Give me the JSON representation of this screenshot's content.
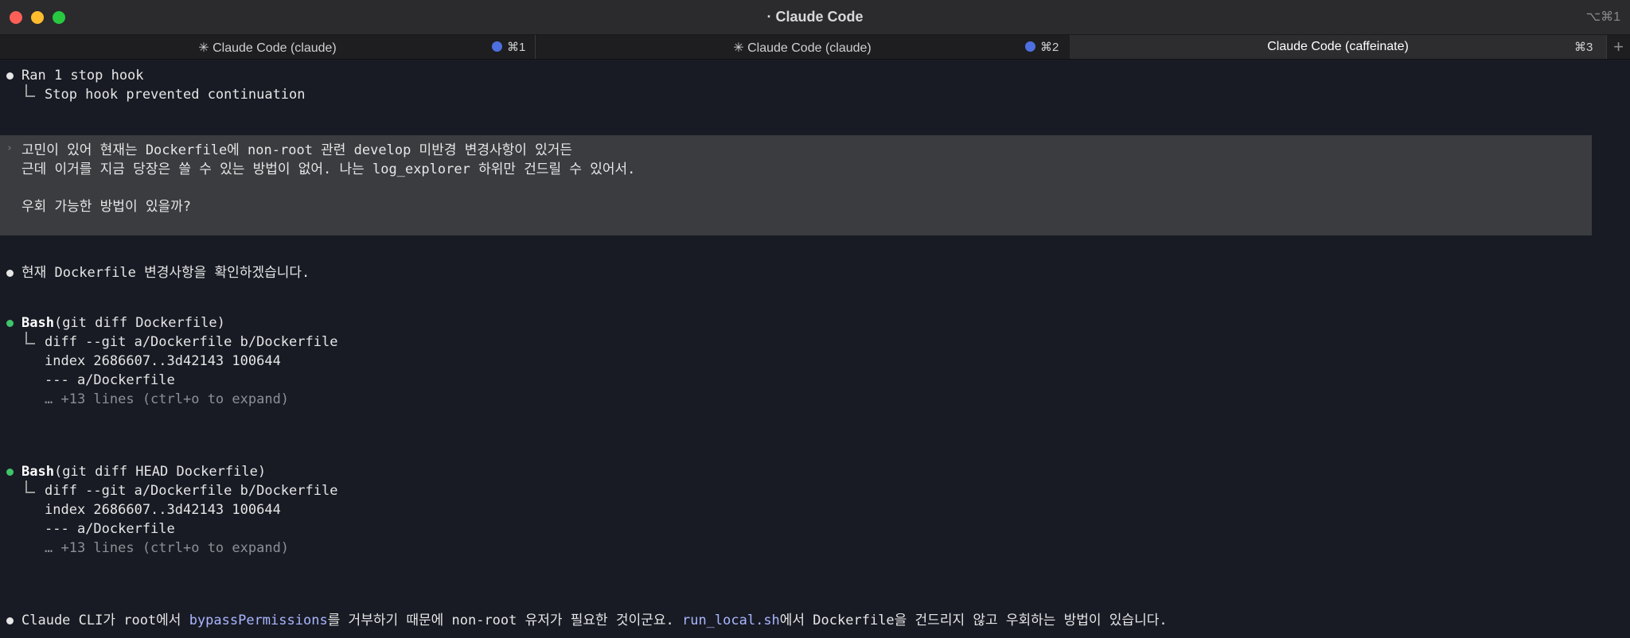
{
  "window": {
    "title": "· Claude Code",
    "shortcut": "⌥⌘1"
  },
  "tabs": [
    {
      "label": "✳ Claude Code (claude)",
      "key": "⌘1",
      "dot": true
    },
    {
      "label": "✳ Claude Code (claude)",
      "key": "⌘2",
      "dot": true
    },
    {
      "label": "Claude Code (caffeinate)",
      "key": "⌘3",
      "dot": false
    }
  ],
  "new_tab": "+",
  "terminal": {
    "hook_line": "Ran 1 stop hook",
    "hook_detail": "Stop hook prevented continuation",
    "user_message": {
      "prompt": "›",
      "line1": "고민이 있어 현재는 Dockerfile에 non-root 관련 develop 미반경 변경사항이 있거든",
      "line2": "근데 이거를 지금 당장은 쓸 수 있는 방법이 없어. 나는 log_explorer 하위만 건드릴 수 있어서.",
      "line3": "우회 가능한 방법이 있을까?"
    },
    "assistant_intro": "현재 Dockerfile 변경사항을 확인하겠습니다.",
    "tool_calls": [
      {
        "name": "Bash",
        "args": "(git diff Dockerfile)",
        "output": [
          "diff --git a/Dockerfile b/Dockerfile",
          "index 2686607..3d42143 100644",
          "--- a/Dockerfile"
        ],
        "more": "… +13 lines (ctrl+o to expand)"
      },
      {
        "name": "Bash",
        "args": "(git diff HEAD Dockerfile)",
        "output": [
          "diff --git a/Dockerfile b/Dockerfile",
          "index 2686607..3d42143 100644",
          "--- a/Dockerfile"
        ],
        "more": "… +13 lines (ctrl+o to expand)"
      }
    ],
    "final": {
      "part1": "Claude CLI가 root에서 ",
      "link1": "bypassPermissions",
      "part2": "를 거부하기 때문에 non-root 유저가 필요한 것이군요. ",
      "link2": "run_local.sh",
      "part3": "에서 Dockerfile을 건드리지 않고 우회하는 방법이 있습니다."
    }
  },
  "colors": {
    "background": "#181b24",
    "user_block": "#3b3c40",
    "bullet_green": "#3fc46a",
    "link": "#a9b6ff",
    "tab_dot": "#4d6fe0"
  }
}
